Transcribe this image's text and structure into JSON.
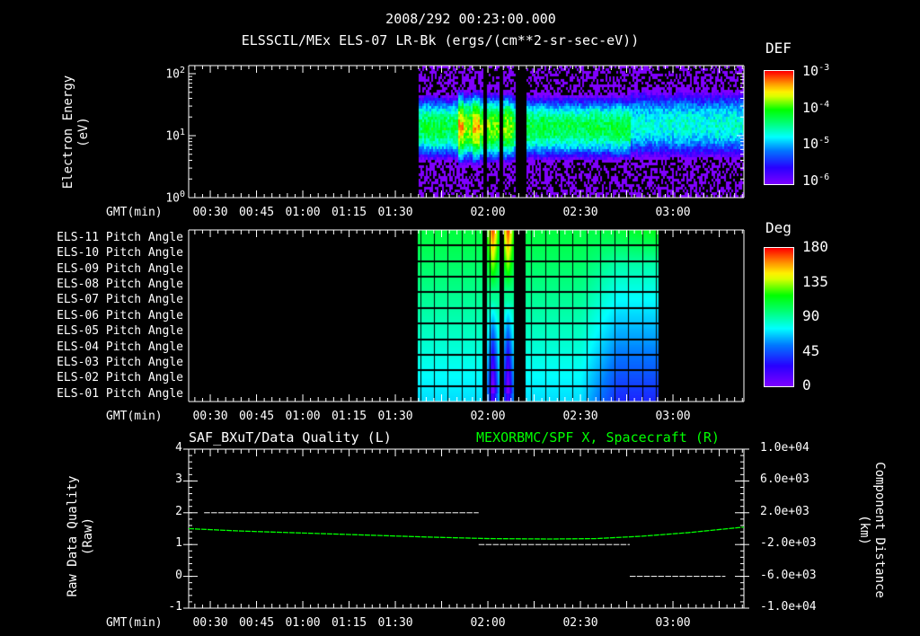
{
  "header": {
    "timestamp": "2008/292 00:23:00.000",
    "panel1_title": "ELSSCIL/MEx ELS-07 LR-Bk  (ergs/(cm**2-sr-sec-eV))"
  },
  "time_axis": {
    "label": "GMT(min)",
    "start_min": 23,
    "end_min": 203,
    "ticks": [
      "00:30",
      "00:45",
      "01:00",
      "01:15",
      "01:30",
      "02:00",
      "02:30",
      "03:00"
    ],
    "tick_minutes": [
      30,
      45,
      60,
      75,
      90,
      120,
      150,
      180
    ]
  },
  "chart_data": [
    {
      "type": "heatmap",
      "name": "energy-spectrogram",
      "title": "ELSSCIL/MEx ELS-07 LR-Bk  (ergs/(cm**2-sr-sec-eV))",
      "ylabel": "Electron Energy (eV)",
      "ylabel_lines": [
        "Electron Energy",
        "(eV)"
      ],
      "yscale": "log",
      "ylim": [
        1,
        135
      ],
      "yticks": [
        {
          "base": "10",
          "exp": "0",
          "value": 1
        },
        {
          "base": "10",
          "exp": "1",
          "value": 10
        },
        {
          "base": "10",
          "exp": "2",
          "value": 100
        }
      ],
      "data_start": "01:37",
      "data_gaps_min": [
        [
          118,
          119.2
        ],
        [
          123.5,
          124.7
        ],
        [
          128.7,
          132
        ]
      ],
      "peak_energy_eV": 14,
      "colorbar": {
        "label": "DEF",
        "scale": "log",
        "range": [
          -6.1,
          -3
        ],
        "ticks": [
          {
            "base": "10",
            "exp": "-3"
          },
          {
            "base": "10",
            "exp": "-4"
          },
          {
            "base": "10",
            "exp": "-5"
          },
          {
            "base": "10",
            "exp": "-6"
          }
        ]
      }
    },
    {
      "type": "heatmap",
      "name": "pitch-angle",
      "rows": [
        "ELS-11 Pitch Angle",
        "ELS-10 Pitch Angle",
        "ELS-09 Pitch Angle",
        "ELS-08 Pitch Angle",
        "ELS-07 Pitch Angle",
        "ELS-06 Pitch Angle",
        "ELS-05 Pitch Angle",
        "ELS-04 Pitch Angle",
        "ELS-03 Pitch Angle",
        "ELS-02 Pitch Angle",
        "ELS-01 Pitch Angle"
      ],
      "data_range_min": [
        97,
        175.3
      ],
      "colorbar": {
        "label": "Deg",
        "range": [
          0,
          180
        ],
        "ticks": [
          "180",
          "135",
          "90",
          "45",
          "0"
        ]
      }
    },
    {
      "type": "line",
      "name": "data-quality-and-position",
      "title_left": "SAF_BXuT/Data Quality (L)",
      "title_right": "MEXORBMC/SPF X, Spacecraft (R)",
      "ylabel_left": [
        "Raw Data Quality",
        "(Raw)"
      ],
      "ylabel_right": [
        "Component Distance",
        "(km)"
      ],
      "ylim_left": [
        -1,
        4
      ],
      "yticks_left": [
        "4",
        "3",
        "2",
        "1",
        "0",
        "-1"
      ],
      "ylim_right": [
        -10000,
        10000
      ],
      "yticks_right": [
        "1.0e+04",
        "6.0e+03",
        "2.0e+03",
        "-2.0e+03",
        "-6.0e+03",
        "-1.0e+04"
      ],
      "series": [
        {
          "name": "Data Quality",
          "color": "#ffffff",
          "segments": [
            {
              "from_min": 28,
              "to_min": 117,
              "value": 2
            },
            {
              "from_min": 117,
              "to_min": 166,
              "value": 1
            },
            {
              "from_min": 166,
              "to_min": 197,
              "value": 0
            }
          ]
        },
        {
          "name": "SPF X Spacecraft (km)",
          "color": "#00ff00",
          "x_min": [
            23,
            40,
            60,
            80,
            100,
            120,
            140,
            155,
            170,
            185,
            203
          ],
          "values": [
            0,
            -300,
            -550,
            -800,
            -1050,
            -1250,
            -1300,
            -1250,
            -950,
            -500,
            200
          ]
        }
      ]
    }
  ]
}
